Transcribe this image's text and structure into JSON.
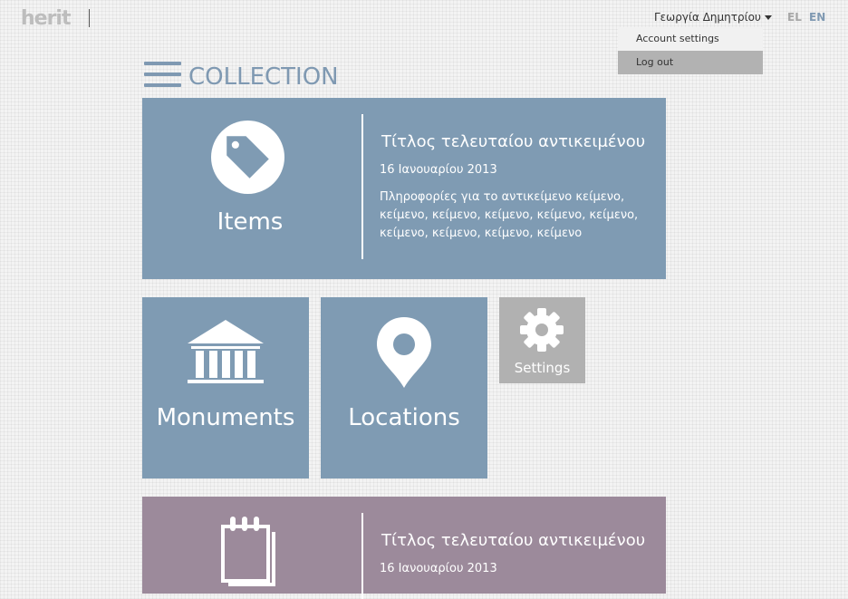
{
  "header": {
    "logo": "herit",
    "user_name": "Γεωργία Δημητρίου",
    "languages": [
      "EL",
      "EN"
    ],
    "active_language": "EN",
    "dropdown": {
      "account_settings": "Account settings",
      "log_out": "Log out"
    }
  },
  "page": {
    "title": "COLLECTION"
  },
  "tiles": {
    "items": {
      "label": "Items",
      "latest_title": "Τίτλος τελευταίου αντικειμένου",
      "latest_date": "16 Ιανουαρίου 2013",
      "latest_desc": "Πληροφορίες για το αντικείμενο κείμενο, κείμενο, κείμενο, κείμενο, κείμενο, κείμενο, κείμενο, κείμενο, κείμενο, κείμενο"
    },
    "monuments": {
      "label": "Monuments"
    },
    "locations": {
      "label": "Locations"
    },
    "settings": {
      "label": "Settings"
    },
    "notes": {
      "latest_title": "Τίτλος τελευταίου αντικειμένου",
      "latest_date": "16 Ιανουαρίου 2013"
    }
  },
  "colors": {
    "tile_blue": "#7f9bb3",
    "tile_mauve": "#9c8a9b",
    "tile_gray": "#b1b1b1",
    "accent": "#7f99b2"
  },
  "icons": {
    "items": "tag-icon",
    "monuments": "bank-icon",
    "locations": "map-pin-icon",
    "settings": "gear-icon",
    "notes": "notepad-icon",
    "menu": "hamburger-icon"
  }
}
